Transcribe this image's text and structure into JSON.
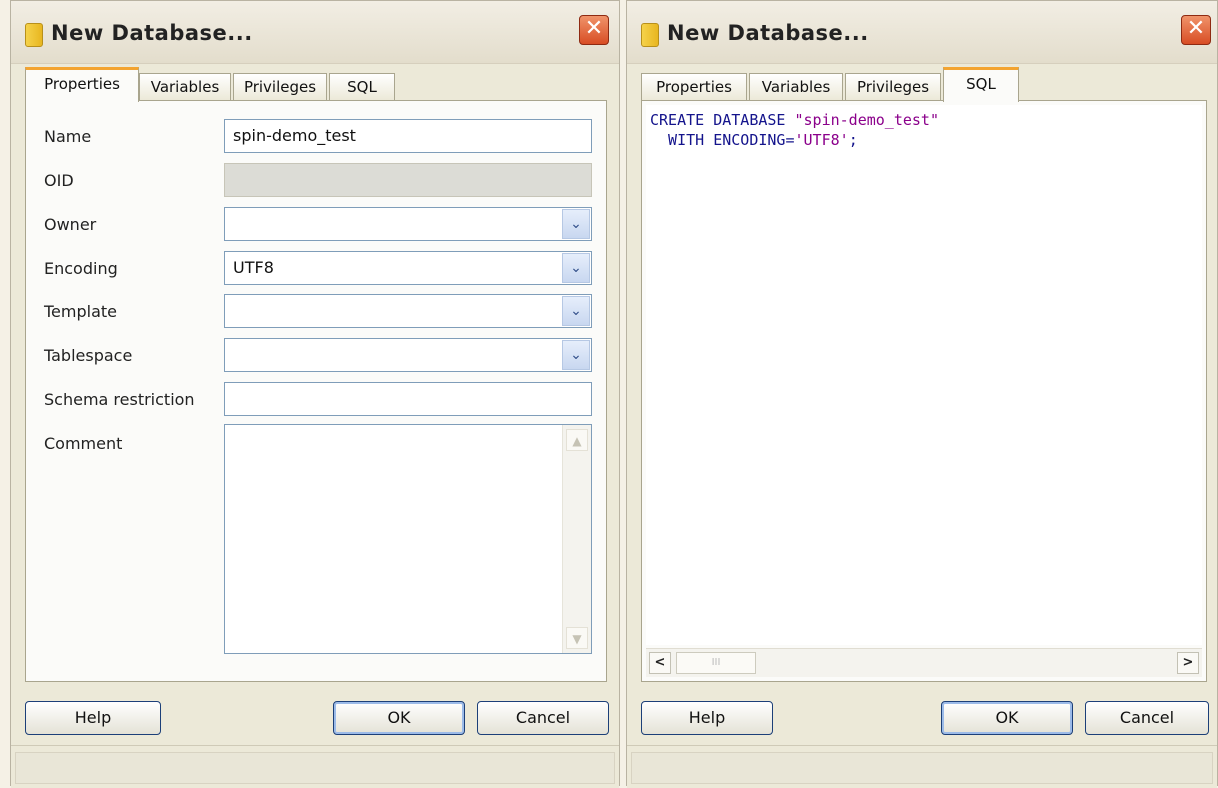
{
  "left_dialog": {
    "title": "New Database...",
    "close_glyph": "✕",
    "tabs": [
      {
        "label": "Properties",
        "active": true
      },
      {
        "label": "Variables",
        "active": false
      },
      {
        "label": "Privileges",
        "active": false
      },
      {
        "label": "SQL",
        "active": false
      }
    ],
    "fields": {
      "name": {
        "label": "Name",
        "value": "spin-demo_test"
      },
      "oid": {
        "label": "OID",
        "value": ""
      },
      "owner": {
        "label": "Owner",
        "value": ""
      },
      "encoding": {
        "label": "Encoding",
        "value": "UTF8"
      },
      "template": {
        "label": "Template",
        "value": ""
      },
      "tablespace": {
        "label": "Tablespace",
        "value": ""
      },
      "schema_restriction": {
        "label": "Schema restriction",
        "value": ""
      },
      "comment": {
        "label": "Comment",
        "value": ""
      }
    },
    "dropdown_glyph": "⌄",
    "buttons": {
      "help": "Help",
      "ok": "OK",
      "cancel": "Cancel"
    }
  },
  "right_dialog": {
    "title": "New Database...",
    "close_glyph": "✕",
    "tabs": [
      {
        "label": "Properties",
        "active": false
      },
      {
        "label": "Variables",
        "active": false
      },
      {
        "label": "Privileges",
        "active": false
      },
      {
        "label": "SQL",
        "active": true
      }
    ],
    "sql": {
      "line1_keyword": "CREATE DATABASE ",
      "line1_string": "\"spin-demo_test\"",
      "line2_keyword": "  WITH ENCODING=",
      "line2_string": "'UTF8'",
      "line2_end": ";"
    },
    "scroll": {
      "left_arrow": "<",
      "right_arrow": ">",
      "thumb_grip": "III"
    },
    "buttons": {
      "help": "Help",
      "ok": "OK",
      "cancel": "Cancel"
    }
  },
  "colors": {
    "dialog_bg": "#ece9d8",
    "sql_keyword": "#14148c",
    "sql_string": "#8b008b",
    "active_tab_accent": "#f3a431",
    "close_button": "#d84d24"
  }
}
